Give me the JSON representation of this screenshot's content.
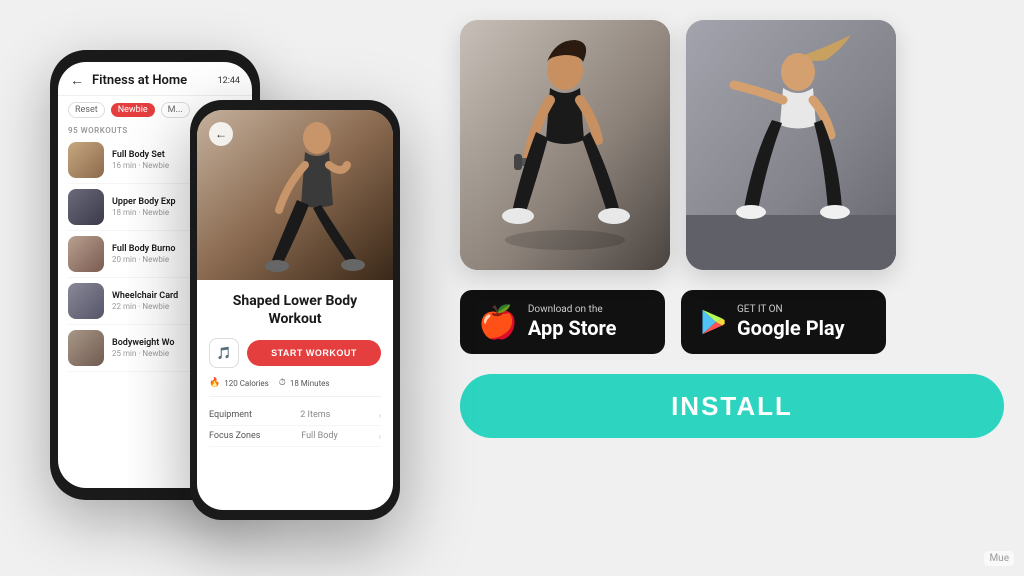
{
  "app": {
    "title": "Fitness at Home",
    "time": "12:44",
    "back_arrow": "←",
    "filters": {
      "reset": "Reset",
      "newbie": "Newbie",
      "more": "M..."
    },
    "workout_count": "95 WORKOUTS",
    "workouts": [
      {
        "name": "Full Body Set",
        "meta": "16 min · Newbie"
      },
      {
        "name": "Upper Body Exp",
        "meta": "18 min · Newbie"
      },
      {
        "name": "Full Body Burno",
        "meta": "20 min · Newbie"
      },
      {
        "name": "Wheelchair Card",
        "meta": "22 min · Newbie"
      },
      {
        "name": "Bodyweight Wo",
        "meta": "25 min · Newbie"
      }
    ],
    "detail": {
      "title": "Shaped Lower Body Workout",
      "start_btn": "START WORKOUT",
      "calories": "120 Calories",
      "minutes": "18 Minutes",
      "equipment_label": "Equipment",
      "equipment_value": "2 Items",
      "focus_label": "Focus Zones",
      "focus_value": "Full Body"
    }
  },
  "store": {
    "appstore": {
      "top": "Download on the",
      "main": "App Store"
    },
    "googleplay": {
      "top": "GET IT ON",
      "main": "Google Play"
    }
  },
  "install": {
    "label": "INSTALL"
  },
  "watermark": "Mue"
}
